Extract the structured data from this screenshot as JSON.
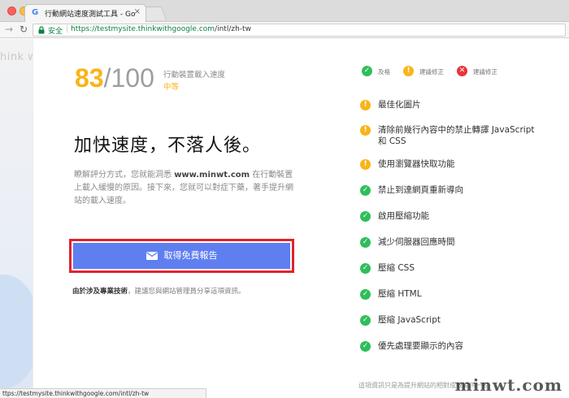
{
  "browser": {
    "tab_title": "行動網站速度測試工具 - Google",
    "tab_close": "×",
    "favicon": "G",
    "secure_label": "安全",
    "url_host": "https://testmysite.thinkwithgoogle.com",
    "url_path": "/intl/zh-tw",
    "status_url": "ttps://testmysite.thinkwithgoogle.com/intl/zh-tw"
  },
  "background": {
    "partial_text": "hink w"
  },
  "score": {
    "value": "83",
    "total": "/100",
    "label": "行動裝置載入速度",
    "grade": "中等"
  },
  "headline": "加快速度，不落人後。",
  "description": {
    "before": "瞭解評分方式，您就能洞悉 ",
    "site": "www.minwt.com",
    "after": " 在行動裝置上載入緩慢的原因。接下來，您就可以對症下藥，著手提升網站的載入速度。"
  },
  "cta_label": "取得免費報告",
  "note": {
    "bold": "由於涉及專業技術",
    "rest": "，建議您與網站管理員分享這項資訊。"
  },
  "legend": [
    {
      "status": "pass",
      "label": "及格"
    },
    {
      "status": "warn",
      "label": "建議修正"
    },
    {
      "status": "fail",
      "label": "建議修正"
    }
  ],
  "rules": [
    {
      "status": "warn",
      "label": "最佳化圖片"
    },
    {
      "status": "warn",
      "label": "清除前幾行內容中的禁止轉譯 JavaScript",
      "label2": "和 CSS"
    },
    {
      "status": "warn",
      "label": "使用瀏覽器快取功能"
    },
    {
      "status": "pass",
      "label": "禁止到達網頁重新導向"
    },
    {
      "status": "pass",
      "label": "啟用壓縮功能"
    },
    {
      "status": "pass",
      "label": "減少伺服器回應時間"
    },
    {
      "status": "pass",
      "label": "壓縮 CSS"
    },
    {
      "status": "pass",
      "label": "壓縮 HTML"
    },
    {
      "status": "pass",
      "label": "壓縮 JavaScript"
    },
    {
      "status": "pass",
      "label": "優先處理要顯示的內容"
    }
  ],
  "footer_text": "這項資訊只是為提升網站的相對成效提供一些",
  "watermark": "minwt.com",
  "colors": {
    "accent_orange": "#f9b418",
    "pass_green": "#2fbe5a",
    "fail_red": "#e8353a",
    "cta_blue": "#5f7ff0",
    "highlight_red": "#e0232e"
  }
}
